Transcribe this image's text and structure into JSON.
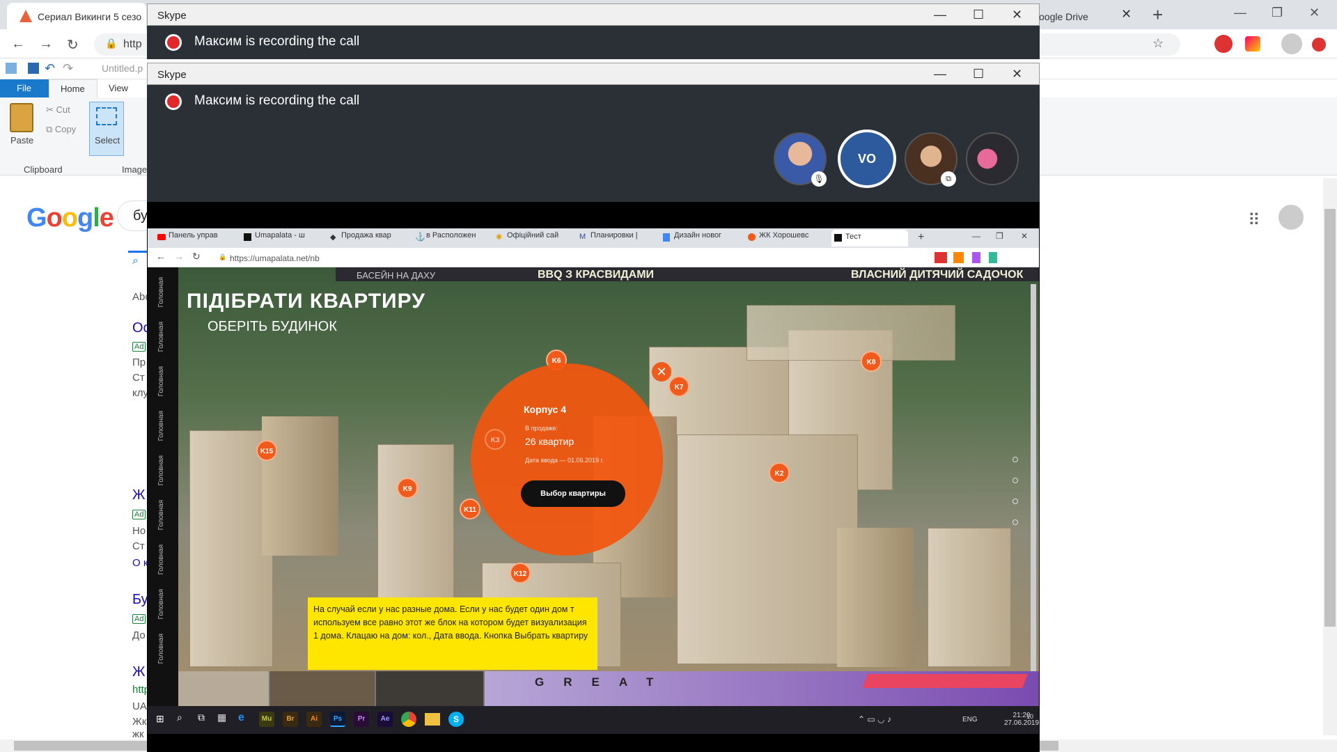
{
  "chrome": {
    "tab_title": "Сериал Викинги 5 сезо",
    "tab2_title": "oogle Drive",
    "tab2_close": "✕",
    "new_tab": "+",
    "url_fragment": "http",
    "win_min": "—",
    "win_max": "❐",
    "win_close": "✕",
    "back": "←",
    "forward": "→",
    "reload": "↻"
  },
  "paint": {
    "title": "Untitled.p",
    "tabs": {
      "file": "File",
      "home": "Home",
      "view": "View"
    },
    "paste_label": "Paste",
    "cut_label": "Cut",
    "copy_label": "Copy",
    "select_label": "Select",
    "clipboard_group": "Clipboard",
    "image_group": "Image"
  },
  "google": {
    "logo_letters": [
      "G",
      "o",
      "o",
      "g",
      "l",
      "e"
    ],
    "search_fragment": "бу",
    "about": "Abo",
    "results": [
      {
        "title": "Ос",
        "ad": "Ad",
        "lines": [
          "Пр",
          "Ст",
          "клу"
        ]
      },
      {
        "title": "Ж",
        "ad": "Ad",
        "lines": [
          "Но",
          "Ст",
          "О к"
        ]
      },
      {
        "title": "Бу",
        "ad": "Ad",
        "lines": [
          "До"
        ]
      },
      {
        "title": "Ж",
        "ad": "",
        "lines": [
          "http",
          "UA",
          "Жк",
          "жк"
        ]
      }
    ]
  },
  "skype": {
    "app_name": "Skype",
    "recording_text": "Максим is recording the call",
    "avatar_initials": "VO",
    "minimize": "—",
    "maximize": "☐",
    "close": "✕"
  },
  "shared": {
    "tabs": [
      "Панель управ",
      "Umapalata - ш",
      "Продажа квар",
      "в Расположен",
      "Офіційний сай",
      "Планировки |",
      "Дизайн новог",
      "ЖК Хорошевс",
      "Тест"
    ],
    "url": "https://umapalata.net/nb",
    "heading": "ПІДІБРАТИ КВАРТИРУ",
    "subheading": "ОБЕРІТЬ БУДИНОК",
    "promo_left": "БАСЕЙН НА ДАХУ",
    "promo_mid": "BBQ З КРАСВИДАМИ",
    "promo_right": "ВЛАСНИЙ ДИТЯЧИЙ САДОЧОК",
    "nav_label": "Головная",
    "pins": [
      "K6",
      "K7",
      "K8",
      "K15",
      "K9",
      "K11",
      "K12",
      "K2",
      "K3"
    ],
    "popup": {
      "title": "Корпус 4",
      "sale_label": "В продаже:",
      "sale_value": "26 квартир",
      "date_text": "Дата ввода — 01.06.2019 г.",
      "button": "Выбор квартиры",
      "close": "✕"
    },
    "note": "На случай если у нас разные дома. Если у нас будет один дом т используем все равно этот же блок на котором будет визуализация 1 дома. Клацаю на дом: кол., Дата ввода. Кнопка Выбрать квартиру",
    "great": "GREAT",
    "taskbar": {
      "apps": [
        "Mu",
        "Br",
        "Ai",
        "Ps",
        "Pr",
        "Ae"
      ],
      "lang": "ENG",
      "time": "21:20",
      "date": "27.06.2019",
      "notif": "10"
    }
  }
}
